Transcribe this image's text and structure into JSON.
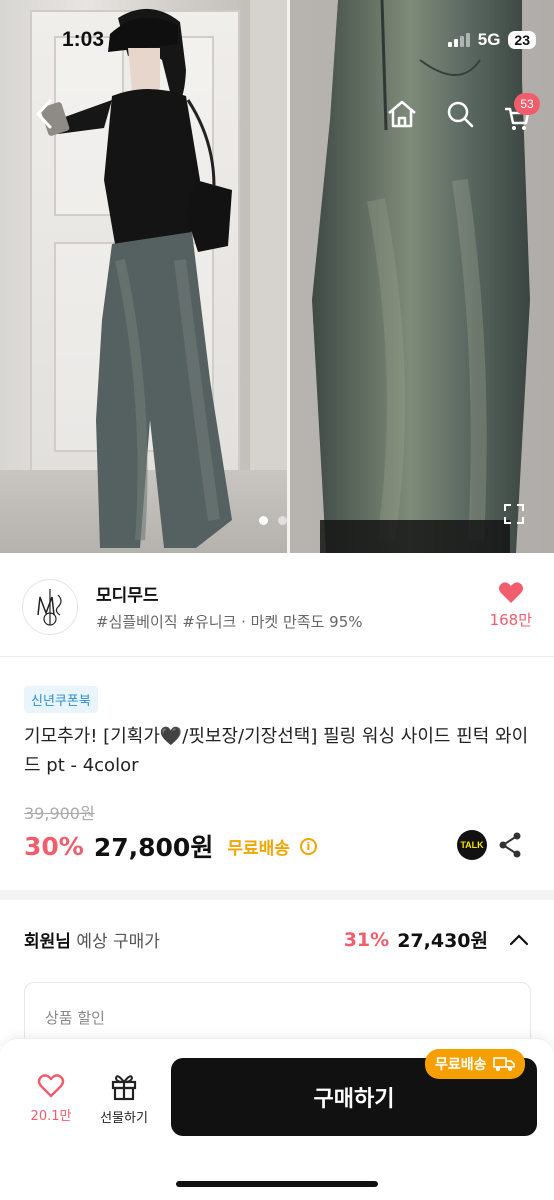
{
  "status_bar": {
    "time": "1:03",
    "network": "5G",
    "battery": "23"
  },
  "gallery": {
    "cart_count": "53",
    "page_count": 2,
    "active_page": 0
  },
  "store": {
    "name": "모디무드",
    "tags": "#심플베이직 #유니크 · 마켓 만족도 95%",
    "like_count": "168만"
  },
  "product": {
    "coupon_badge": "신년쿠폰북",
    "title": "기모추가! [기획가🖤/핏보장/기장선택] 필링 워싱 사이드 핀턱 와이드 pt - 4color",
    "original_price": "39,900원",
    "discount": "30%",
    "price": "27,800원",
    "shipping": "무료배송",
    "talk_label": "TALK"
  },
  "member": {
    "label_bold": "회원님",
    "label_rest": " 예상 구매가",
    "discount": "31%",
    "price": "27,430원"
  },
  "discount_card": {
    "title": "상품 할인"
  },
  "bottom_bar": {
    "like_count": "20.1만",
    "gift_label": "선물하기",
    "buy_label": "구매하기",
    "shipping_pill": "무료배송"
  },
  "colors": {
    "accent_pink": "#f25d6b",
    "shipping_orange": "#f0a500",
    "buy_black": "#111111"
  }
}
